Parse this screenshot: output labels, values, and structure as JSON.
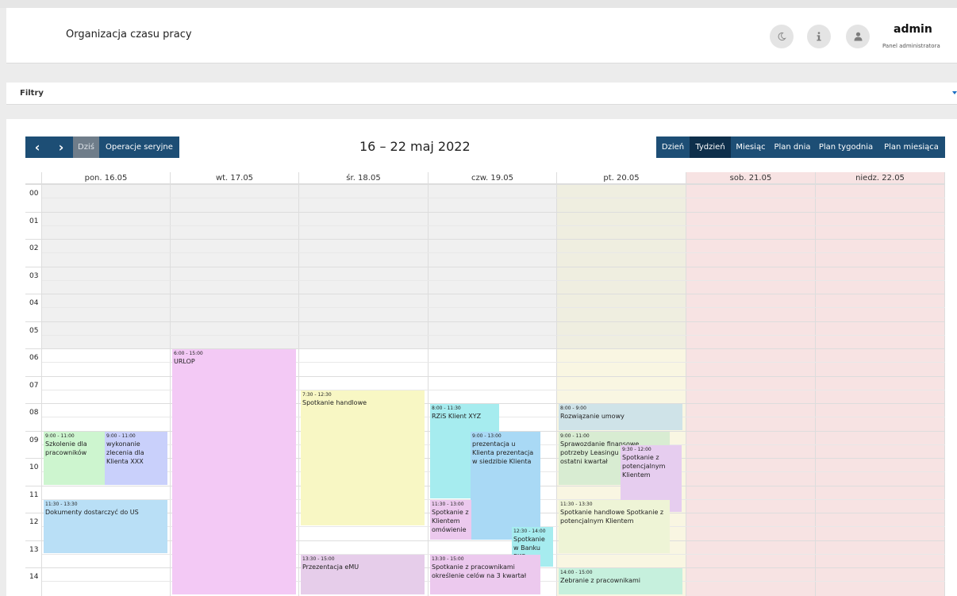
{
  "header": {
    "title": "Organizacja czasu pracy",
    "user_name": "admin",
    "user_role": "Panel administratora"
  },
  "icons": {
    "theme": "moon-icon",
    "info": "info-icon",
    "user": "user-icon"
  },
  "filters": {
    "label": "Filtry"
  },
  "toolbar": {
    "prev": "‹",
    "next": "›",
    "today": "Dziś",
    "series": "Operacje seryjne"
  },
  "calendar_title": "16 – 22 maj 2022",
  "views": [
    "Dzień",
    "Tydzień",
    "Miesiąc",
    "Plan dnia",
    "Plan tygodnia",
    "Plan miesiąca"
  ],
  "active_view": "Tydzień",
  "days": [
    "pon. 16.05",
    "wt. 17.05",
    "śr. 18.05",
    "czw. 19.05",
    "pt. 20.05",
    "sob. 21.05",
    "niedz. 22.05"
  ],
  "hours": [
    "00",
    "01",
    "02",
    "03",
    "04",
    "05",
    "06",
    "07",
    "08",
    "09",
    "10",
    "11",
    "12",
    "13",
    "14"
  ],
  "colors": {
    "accent": "#1d4e75",
    "accent_active": "#0e2f4b",
    "weekend_bg": "#f7e3e3",
    "today_bg": "#f9f6e2",
    "offhours_bg": "#f0f0f0"
  },
  "events": [
    {
      "day": 0,
      "time": "9:00 - 11:00",
      "title": "Szkolenie dla pracowników",
      "color": "#cdf5cf"
    },
    {
      "day": 0,
      "time": "9:00 - 11:00",
      "title": "wykonanie zlecenia dla Klienta XXX",
      "color": "#c9d0fb"
    },
    {
      "day": 0,
      "time": "11:30 - 13:30",
      "title": "Dokumenty dostarczyć do US",
      "color": "#b9dff6"
    },
    {
      "day": 1,
      "time": "6:00 - 15:00",
      "title": "URLOP",
      "color": "#f3c9f5"
    },
    {
      "day": 2,
      "time": "7:30 - 12:30",
      "title": "Spotkanie handlowe",
      "color": "#f8f7c4"
    },
    {
      "day": 2,
      "time": "13:30 - 15:00",
      "title": "Przezentacja eMU",
      "color": "#e6cdea"
    },
    {
      "day": 3,
      "time": "8:00 - 11:30",
      "title": "RZiS Klient XYZ",
      "color": "#a6ecef"
    },
    {
      "day": 3,
      "time": "9:00 - 13:00",
      "title": "prezentacja u Klienta prezentacja w siedzibie Klienta",
      "color": "#a9d9f5"
    },
    {
      "day": 3,
      "time": "11:30 - 13:00",
      "title": "Spotkanie z Klientem omówienie",
      "color": "#ecc9ee"
    },
    {
      "day": 3,
      "time": "12:30 - 14:00",
      "title": "Spotkanie w Banku PKO",
      "color": "#a6ecef"
    },
    {
      "day": 3,
      "time": "13:30 - 15:00",
      "title": "Spotkanie z pracownikami określenie celów na 3 kwartał",
      "color": "#ecc9ee"
    },
    {
      "day": 4,
      "time": "8:00 - 9:00",
      "title": "Rozwiązanie umowy",
      "color": "#cfe3e8"
    },
    {
      "day": 4,
      "time": "9:00 - 11:00",
      "title": "Sprawozdanie finansowe potrzeby Leasingu RZiS za ostatni kwartał",
      "color": "#d8ecd2"
    },
    {
      "day": 4,
      "time": "9:30 - 12:00",
      "title": "Spotkanie z potencjalnym Klientem",
      "color": "#e6cdef"
    },
    {
      "day": 4,
      "time": "11:30 - 13:30",
      "title": "Spotkanie handlowe Spotkanie z potencjalnym Klientem",
      "color": "#eef4d6"
    },
    {
      "day": 4,
      "time": "14:00 - 15:00",
      "title": "Zebranie z pracownikami",
      "color": "#c6f0dd"
    }
  ]
}
